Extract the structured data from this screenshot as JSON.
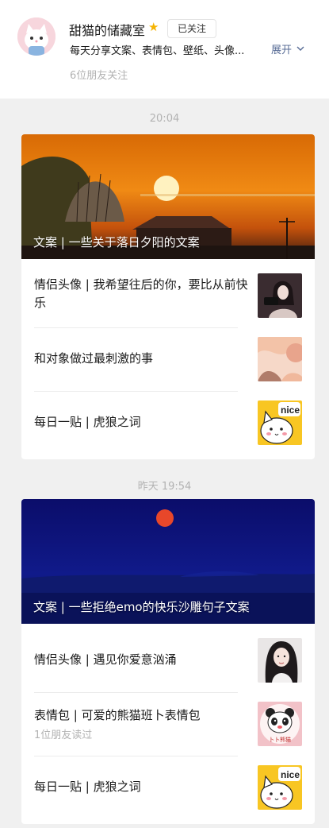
{
  "profile": {
    "name": "甜猫的储藏室",
    "star_icon": "star-icon",
    "follow_label": "已关注",
    "description": "每天分享文案、表情包、壁纸、头像...",
    "expand_label": "展开",
    "friends_text": "6位朋友关注"
  },
  "groups": [
    {
      "time": "20:04",
      "hero_title": "文案 | 一些关于落日夕阳的文案",
      "items": [
        {
          "title": "情侣头像 | 我希望往后的你，要比从前快乐",
          "sub": ""
        },
        {
          "title": "和对象做过最刺激的事",
          "sub": ""
        },
        {
          "title": "每日一贴 | 虎狼之词",
          "sub": ""
        }
      ]
    },
    {
      "time": "昨天  19:54",
      "hero_title": "文案 | 一些拒绝emo的快乐沙雕句子文案",
      "items": [
        {
          "title": "情侣头像 | 遇见你爱意汹涌",
          "sub": ""
        },
        {
          "title": "表情包 | 可爱的熊猫班卜表情包",
          "sub": "1位朋友读过"
        },
        {
          "title": "每日一贴 | 虎狼之词",
          "sub": ""
        }
      ]
    }
  ],
  "thumb_text": {
    "nice": "nice",
    "panda_caption": "卜卜熊猫"
  }
}
